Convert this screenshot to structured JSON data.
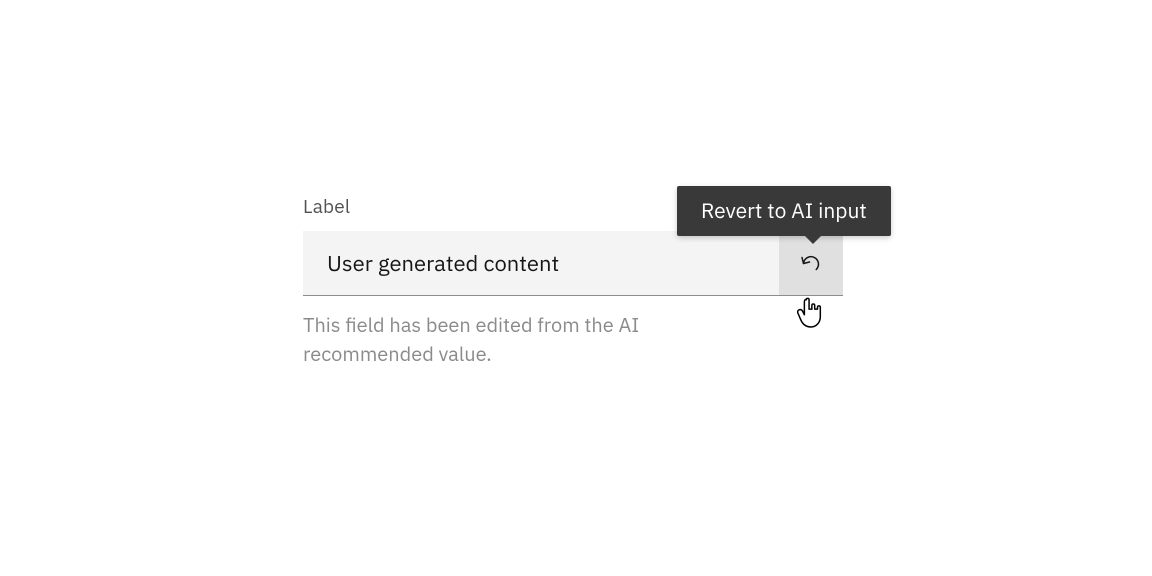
{
  "field": {
    "label": "Label",
    "value": "User generated content",
    "helper": "This field has been edited from the AI recommended value.",
    "tooltip": "Revert to AI input"
  }
}
